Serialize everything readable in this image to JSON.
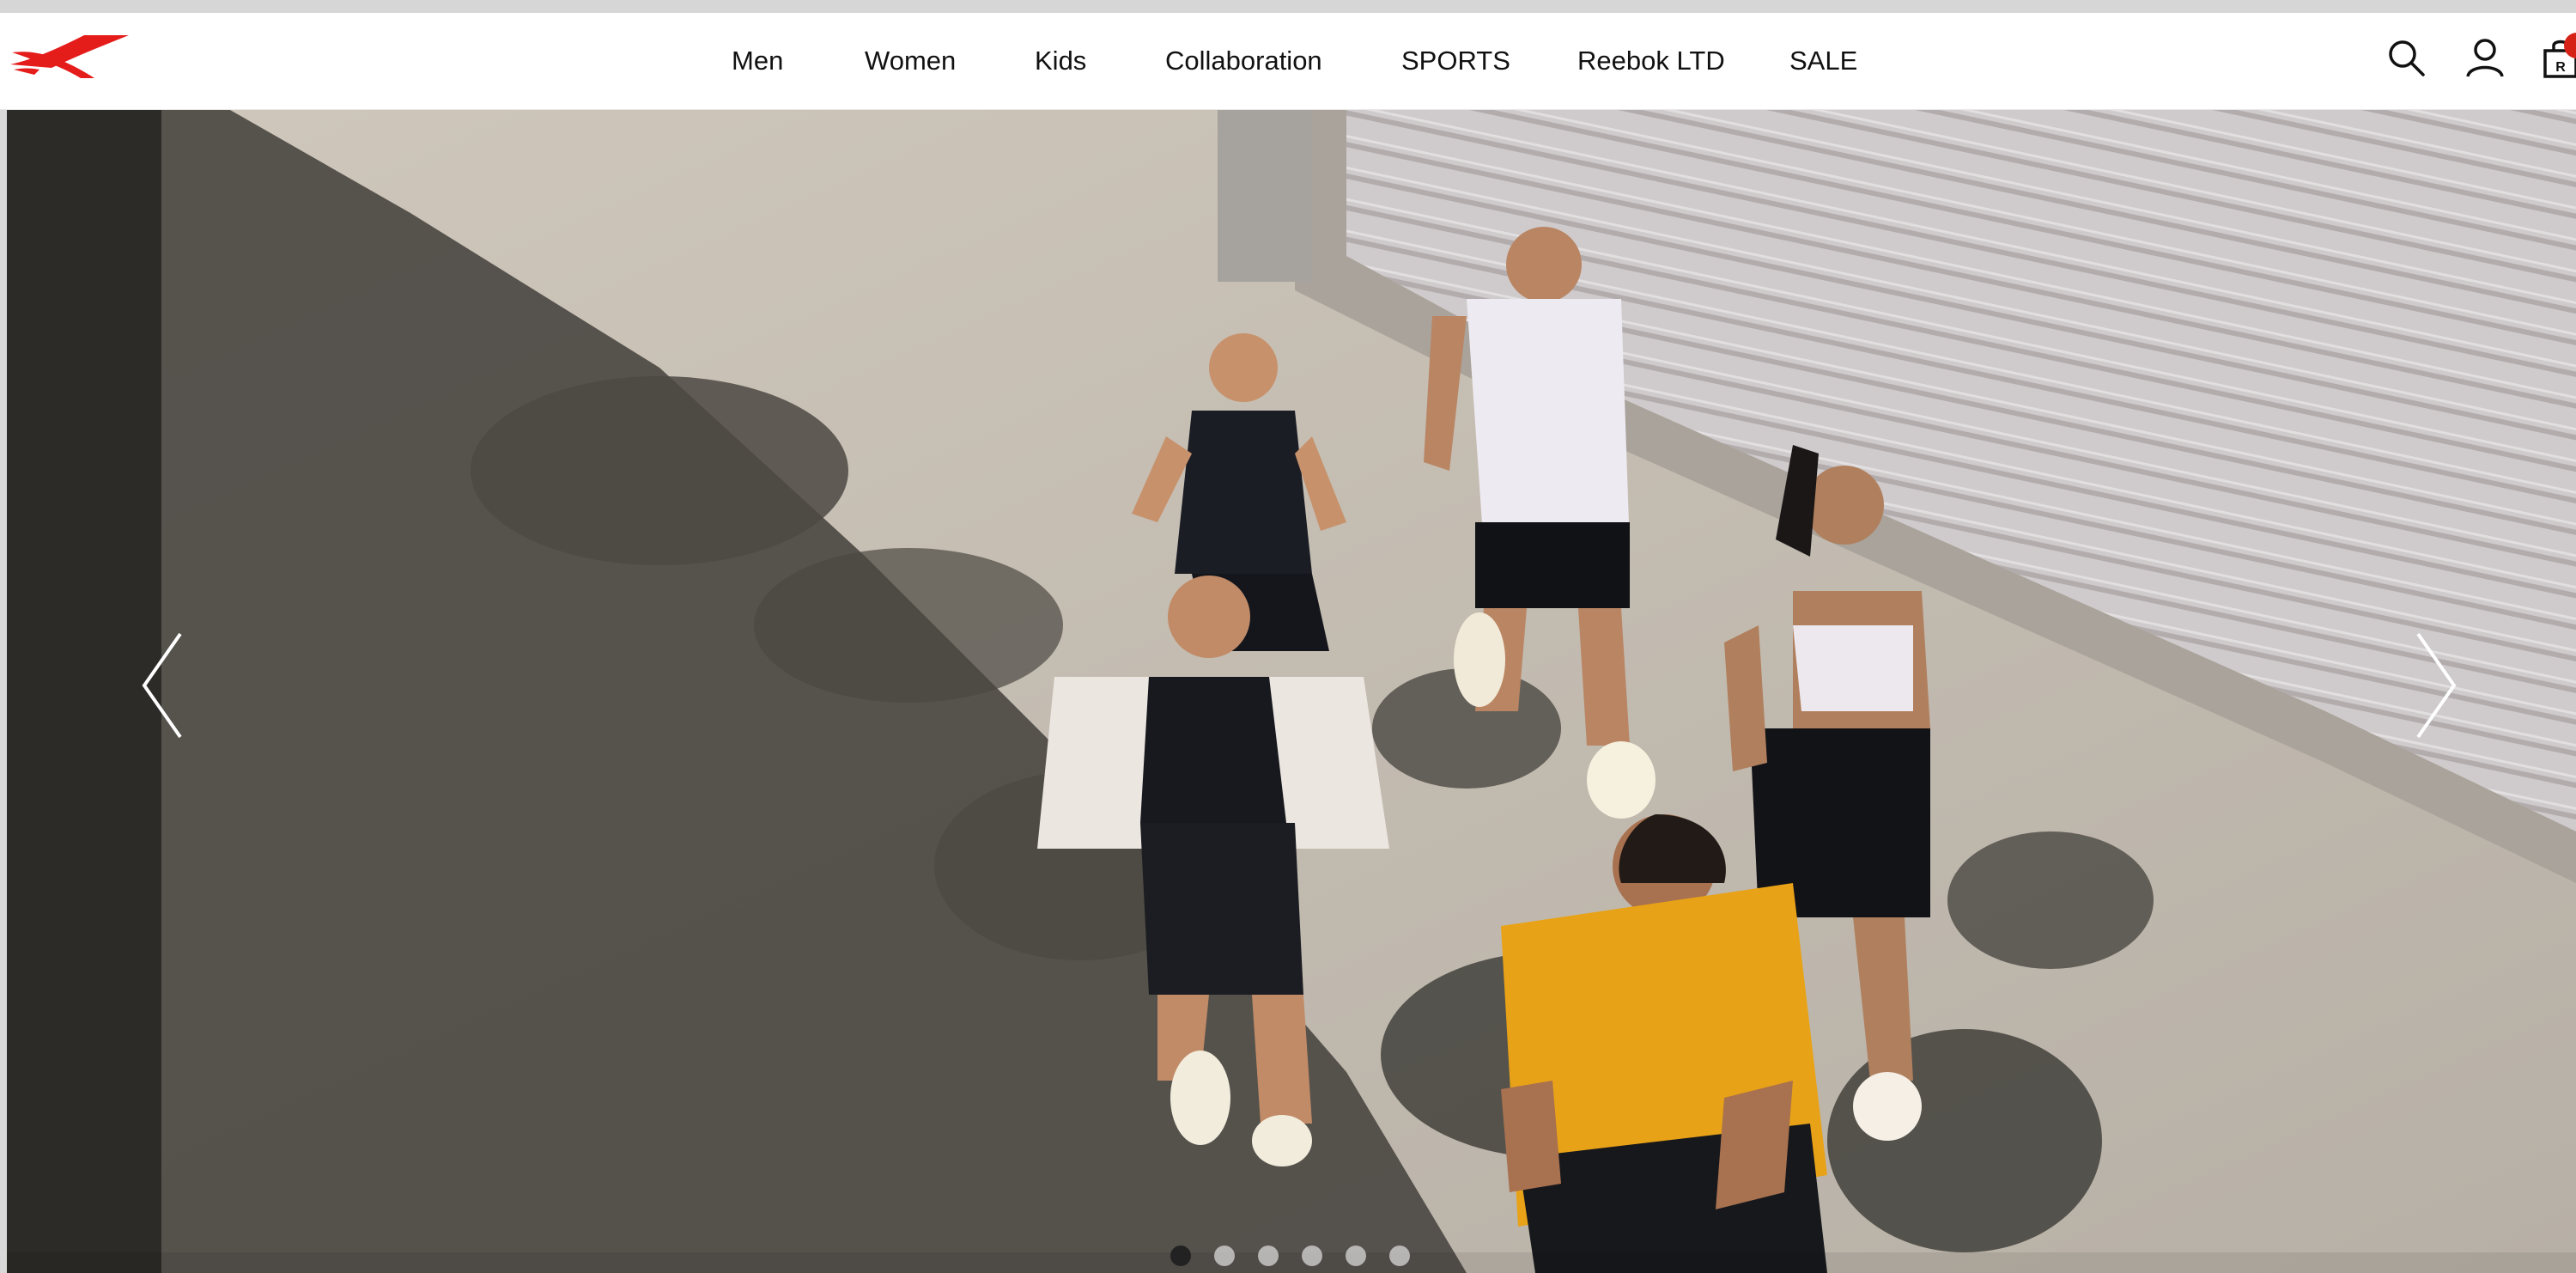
{
  "brand": {
    "logo_icon": "reebok-vector-logo",
    "accent_color": "#e41d1b"
  },
  "nav": {
    "items": [
      {
        "label": "Men"
      },
      {
        "label": "Women"
      },
      {
        "label": "Kids"
      },
      {
        "label": "Collaboration"
      },
      {
        "label": "SPORTS"
      },
      {
        "label": "Reebok LTD"
      },
      {
        "label": "SALE"
      }
    ]
  },
  "header_icons": {
    "search": "search-icon",
    "account": "user-icon",
    "cart": "shopping-bag-icon",
    "cart_bag_letter": "R",
    "cart_badge_color": "#d62216"
  },
  "hero": {
    "image_description_icon": "hero-photo",
    "prev_icon": "chevron-left-icon",
    "next_icon": "chevron-right-icon",
    "slide_count": 6,
    "active_slide": 1
  }
}
